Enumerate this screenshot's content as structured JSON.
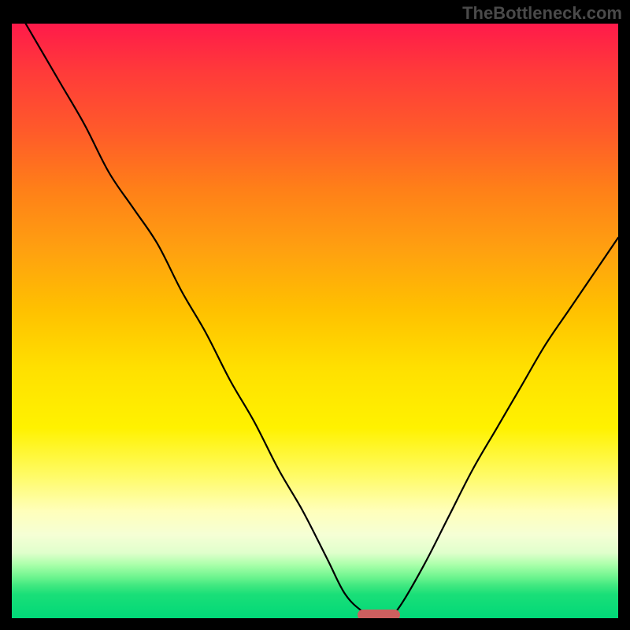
{
  "watermark": "TheBottleneck.com",
  "chart_data": {
    "type": "line",
    "title": "",
    "xlabel": "",
    "ylabel": "",
    "xlim": [
      0,
      100
    ],
    "ylim": [
      0,
      100
    ],
    "x": [
      0,
      4,
      8,
      12,
      16,
      20,
      24,
      28,
      32,
      36,
      40,
      44,
      48,
      52,
      55,
      58,
      60,
      62,
      64,
      68,
      72,
      76,
      80,
      84,
      88,
      92,
      96,
      100
    ],
    "y": [
      104,
      97,
      90,
      83,
      75,
      69,
      63,
      55,
      48,
      40,
      33,
      25,
      18,
      10,
      4,
      1,
      0,
      0,
      2,
      9,
      17,
      25,
      32,
      39,
      46,
      52,
      58,
      64
    ],
    "marker": {
      "x": 60.5,
      "y": 0.5
    },
    "background_gradient": {
      "top": "#ff1a4a",
      "mid": "#ffe000",
      "bottom": "#00d878"
    }
  }
}
